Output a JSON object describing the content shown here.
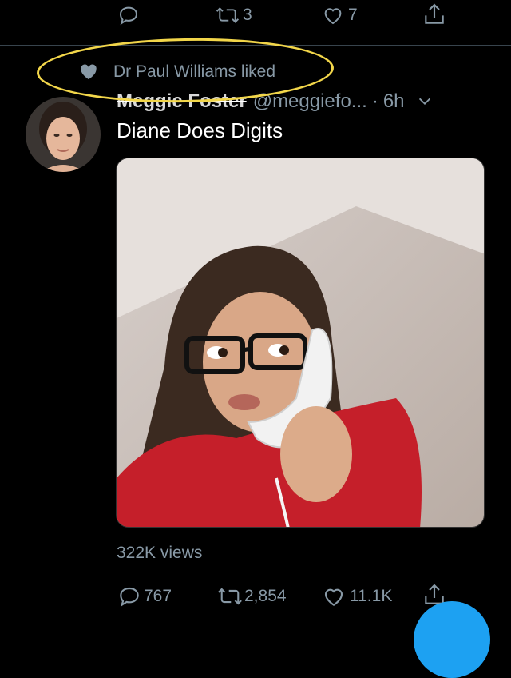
{
  "prev_tweet_actions": {
    "reply_count": "",
    "retweet_count": "3",
    "like_count": "7"
  },
  "social_context": {
    "text": "Dr Paul Williams liked"
  },
  "tweet": {
    "author_name": "Meggie Foster",
    "handle": "@meggiefo...",
    "separator": "·",
    "time": "6h",
    "text": "Diane Does Digits",
    "views": "322K views",
    "reply_count": "767",
    "retweet_count": "2,854",
    "like_count": "11.1K"
  },
  "colors": {
    "background": "#000000",
    "muted": "#8899a6",
    "highlight_ellipse": "#f2d64a",
    "fab": "#1da1f2"
  },
  "icons": [
    "reply-icon",
    "retweet-icon",
    "like-icon",
    "share-icon",
    "heart-icon",
    "chevron-down-icon",
    "compose-fab"
  ]
}
